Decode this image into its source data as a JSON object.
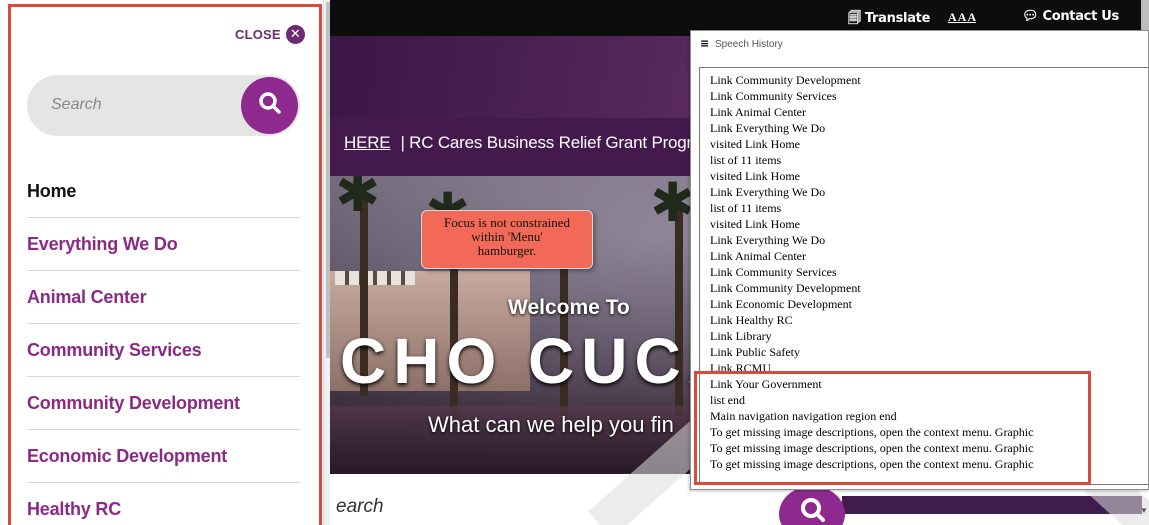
{
  "topbar": {
    "translate": "Translate",
    "translate_icon": "translate-icon",
    "text_size": "A A A",
    "contact": "Contact Us",
    "contact_icon": "speech-bubble-icon"
  },
  "alert": {
    "here": "HERE",
    "text": "| RC Cares Business Relief Grant Program"
  },
  "hero": {
    "welcome": "Welcome To",
    "city": "CHO CUCA",
    "tagline": "What can we help you fin"
  },
  "bottom_search": {
    "text": "earch",
    "icon": "search-icon"
  },
  "menu": {
    "close_label": "CLOSE",
    "close_icon": "close-circle-icon",
    "search_placeholder": "Search",
    "search_icon": "search-icon",
    "items": [
      {
        "label": "Home",
        "current": true
      },
      {
        "label": "Everything We Do"
      },
      {
        "label": "Animal Center"
      },
      {
        "label": "Community Services"
      },
      {
        "label": "Community Development"
      },
      {
        "label": "Economic Development"
      },
      {
        "label": "Healthy RC"
      }
    ]
  },
  "callout": {
    "text": "Focus is not constrained within 'Menu' hamburger."
  },
  "speech_history": {
    "title": "Speech History",
    "lines": [
      "Link Community Development",
      "Link Community Services",
      "Link Animal Center",
      "Link Everything We Do",
      "visited Link Home",
      "list of 11 items",
      "visited Link Home",
      "Link Everything We Do",
      "list of 11 items",
      "visited Link Home",
      "Link Everything We Do",
      "Link Animal Center",
      "Link Community Services",
      "Link Community Development",
      "Link Economic Development",
      "Link Healthy RC",
      "Link Library",
      "Link Public Safety",
      "Link RCMU",
      "Link Your Government",
      "list end",
      "Main navigation navigation region end",
      "To get missing image descriptions, open the context menu. Graphic",
      "To get missing image descriptions, open the context menu. Graphic",
      "To get missing image descriptions, open the context menu. Graphic"
    ]
  },
  "colors": {
    "brand_purple": "#8e2a8f",
    "annotation_red": "#d94a3c",
    "callout_fill": "#f26a57"
  }
}
